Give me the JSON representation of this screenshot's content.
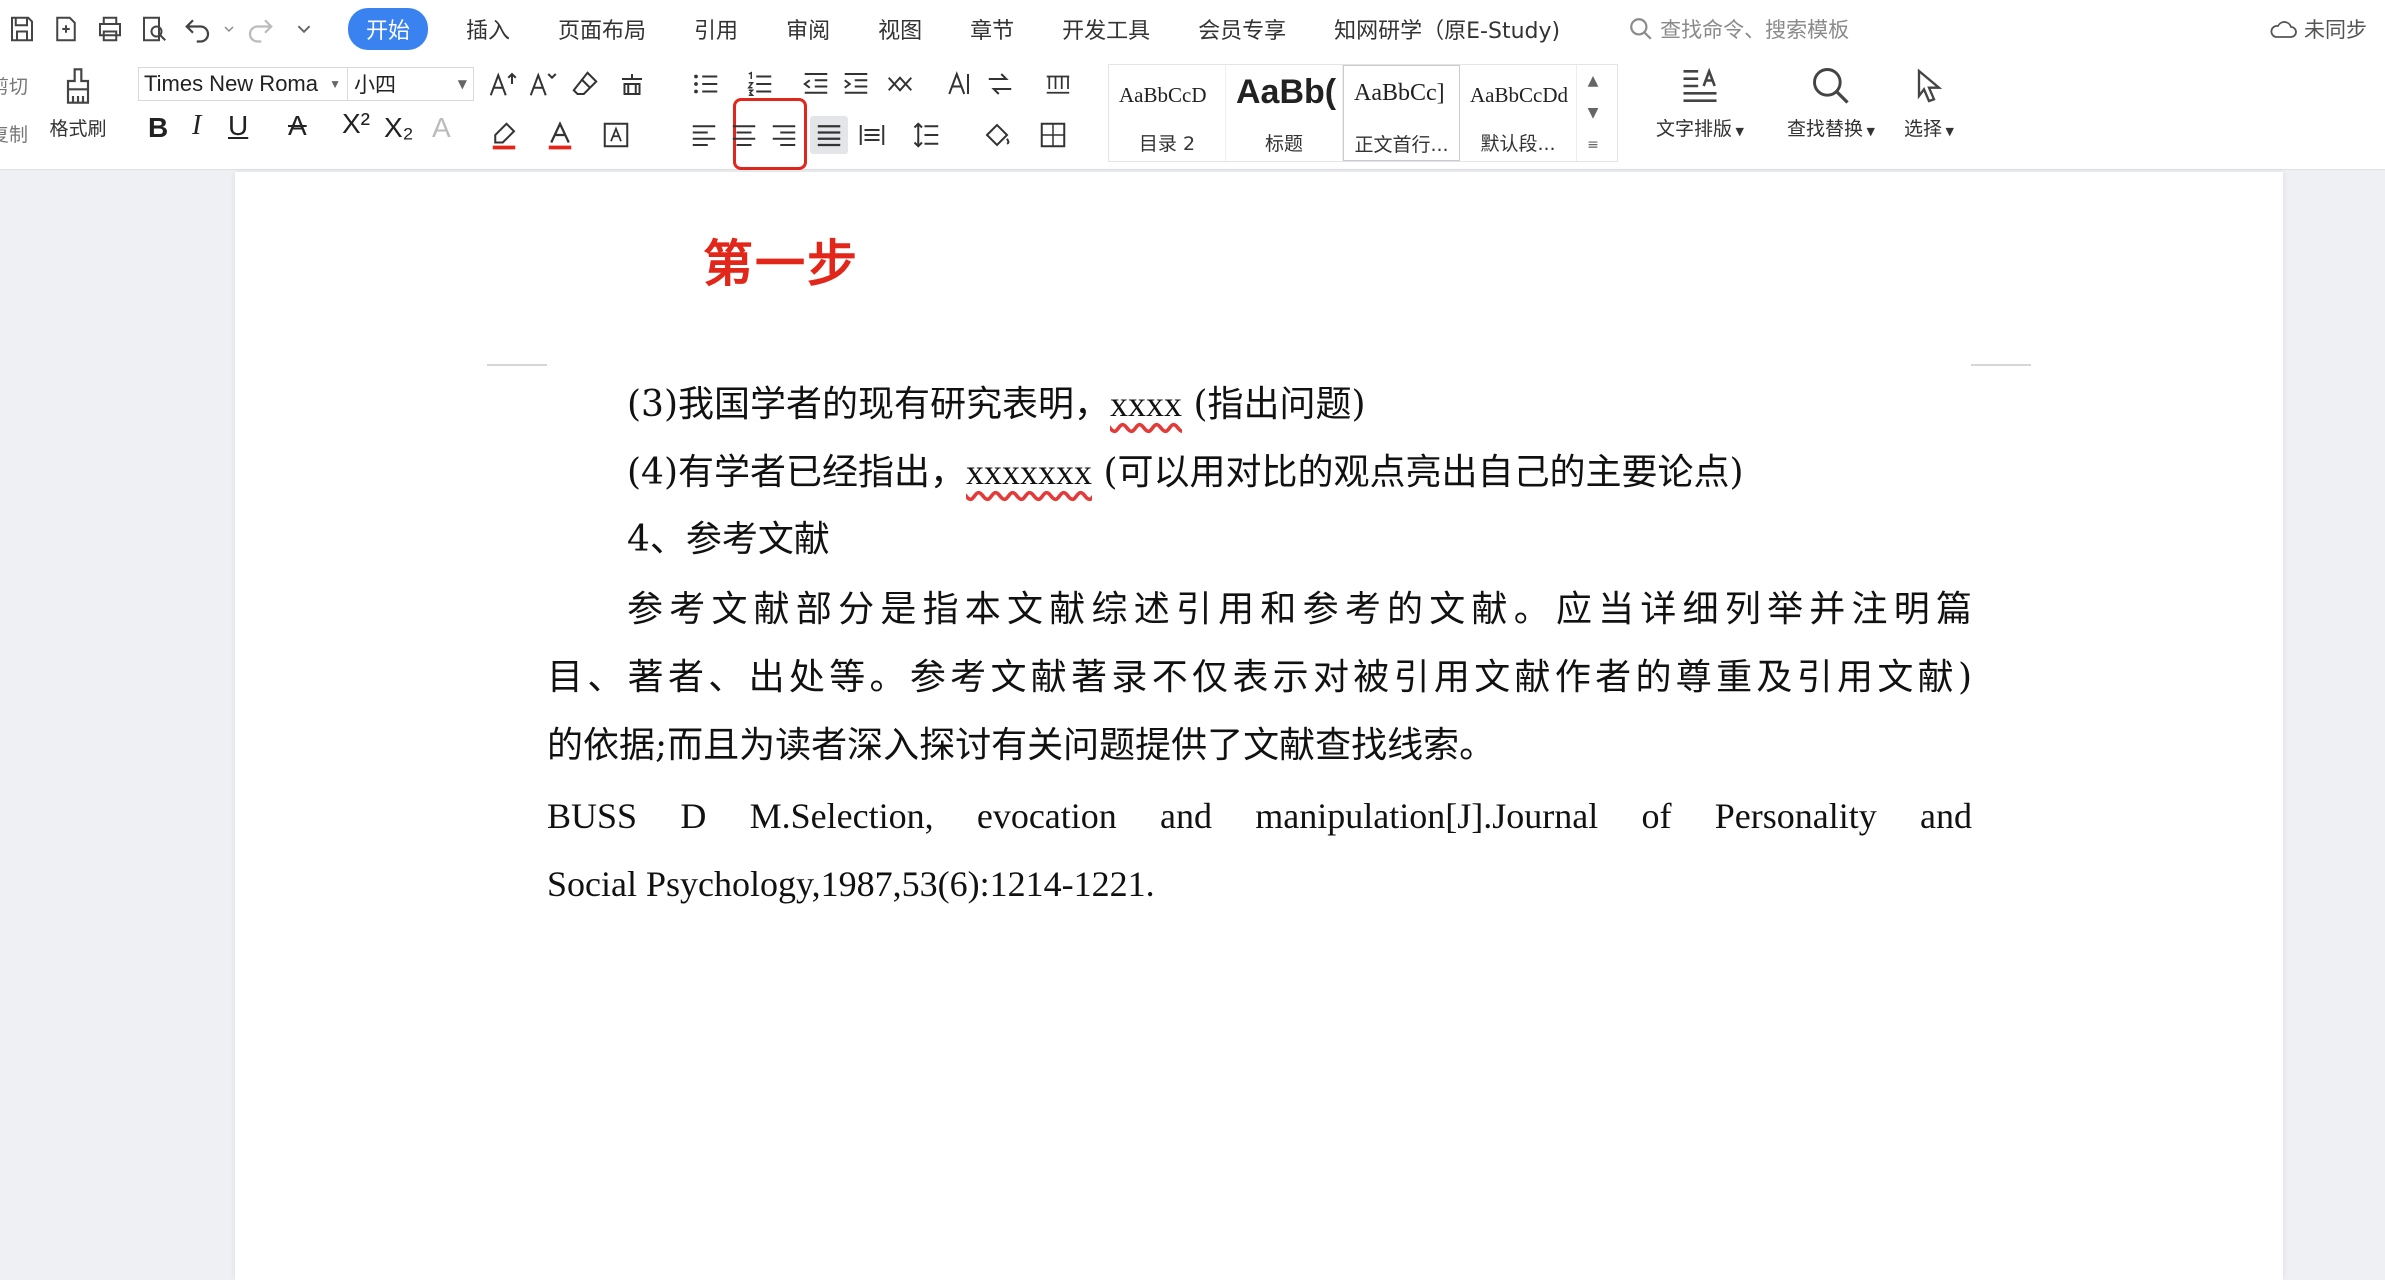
{
  "menubar": {
    "tabs": [
      "开始",
      "插入",
      "页面布局",
      "引用",
      "审阅",
      "视图",
      "章节",
      "开发工具",
      "会员专享",
      "知网研学（原E-Study)"
    ],
    "search_placeholder": "查找命令、搜索模板",
    "sync_label": "未同步"
  },
  "ribbon": {
    "cut_label": "剪切",
    "copy_label": "复制",
    "format_painter_label": "格式刷",
    "font_name": "Times New Roma",
    "font_size": "小四",
    "styles": [
      {
        "sample": "AaBbCcD",
        "name": "目录 2"
      },
      {
        "sample": "AaBb(",
        "name": "标题"
      },
      {
        "sample": "AaBbCc]",
        "name": "正文首行..."
      },
      {
        "sample": "AaBbCcDd",
        "name": "默认段..."
      }
    ],
    "text_layout_label": "文字排版",
    "find_replace_label": "查找替换",
    "select_label": "选择"
  },
  "document": {
    "step_title": "第一步",
    "line1_prefix": "(3)我国学者的现有研究表明，",
    "line1_placeholder": "xxxx",
    "line1_suffix": " (指出问题)",
    "line2_prefix": "(4)有学者已经指出，",
    "line2_placeholder": "xxxxxxx",
    "line2_suffix": " (可以用对比的观点亮出自己的主要论点)",
    "heading4": "4、参考文献",
    "para_line1": "参考文献部分是指本文献综述引用和参考的文献。应当详细列举并注明篇",
    "para_line2": "目、著者、出处等。参考文献著录不仅表示对被引用文献作者的尊重及引用文献)",
    "para_line3": "的依据;而且为读者深入探讨有关问题提供了文献查找线索。",
    "ref_line1": "BUSS D M.Selection, evocation and manipulation[J].Journal of Personality and",
    "ref_line2": "Social Psychology,1987,53(6):1214-1221."
  },
  "colors": {
    "accent": "#3a82f0",
    "step_title": "#e3261a",
    "highlight_box": "#e1261c"
  }
}
